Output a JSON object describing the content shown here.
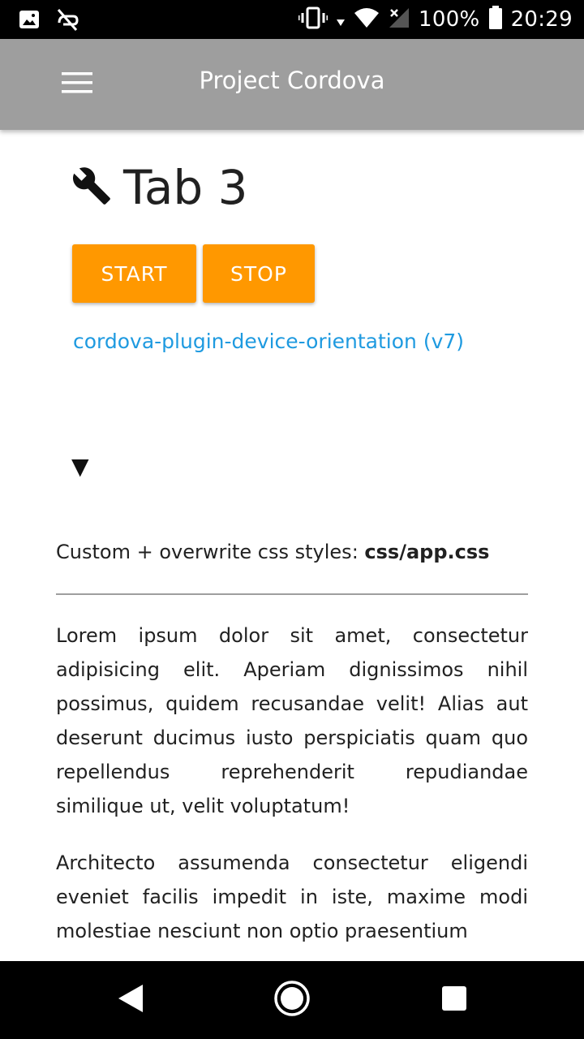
{
  "status_bar": {
    "battery_text": "100%",
    "time": "20:29",
    "icons": [
      "image-icon",
      "sync-disabled-icon",
      "vibrate-icon",
      "data-arrow-icon",
      "wifi-icon",
      "no-signal-icon",
      "battery-icon"
    ]
  },
  "app_bar": {
    "title": "Project Cordova",
    "menu_icon": "hamburger-menu-icon"
  },
  "main": {
    "tab_icon": "wrench-icon",
    "tab_title": "Tab 3",
    "buttons": {
      "start_label": "START",
      "stop_label": "STOP"
    },
    "plugin_link": "cordova-plugin-device-orientation (v7)",
    "toggle_arrow": "▼",
    "css_note_prefix": "Custom + overwrite css styles: ",
    "css_note_file": "css/app.css",
    "paragraphs": [
      "Lorem ipsum dolor sit amet, consectetur adipisicing elit. Aperiam dignissimos nihil possimus, quidem recusandae velit! Alias aut deserunt ducimus iusto perspiciatis quam quo repellendus reprehenderit repudiandae similique ut, velit voluptatum!",
      "Architecto assumenda consectetur eligendi eveniet facilis impedit in iste, maxime modi molestiae nesciunt non optio praesentium"
    ]
  },
  "colors": {
    "app_bar": "#9e9e9e",
    "accent_button": "#ff9800",
    "link": "#1e9ae0"
  },
  "nav_bar": {
    "icons": [
      "back-icon",
      "home-icon",
      "recents-icon"
    ]
  }
}
